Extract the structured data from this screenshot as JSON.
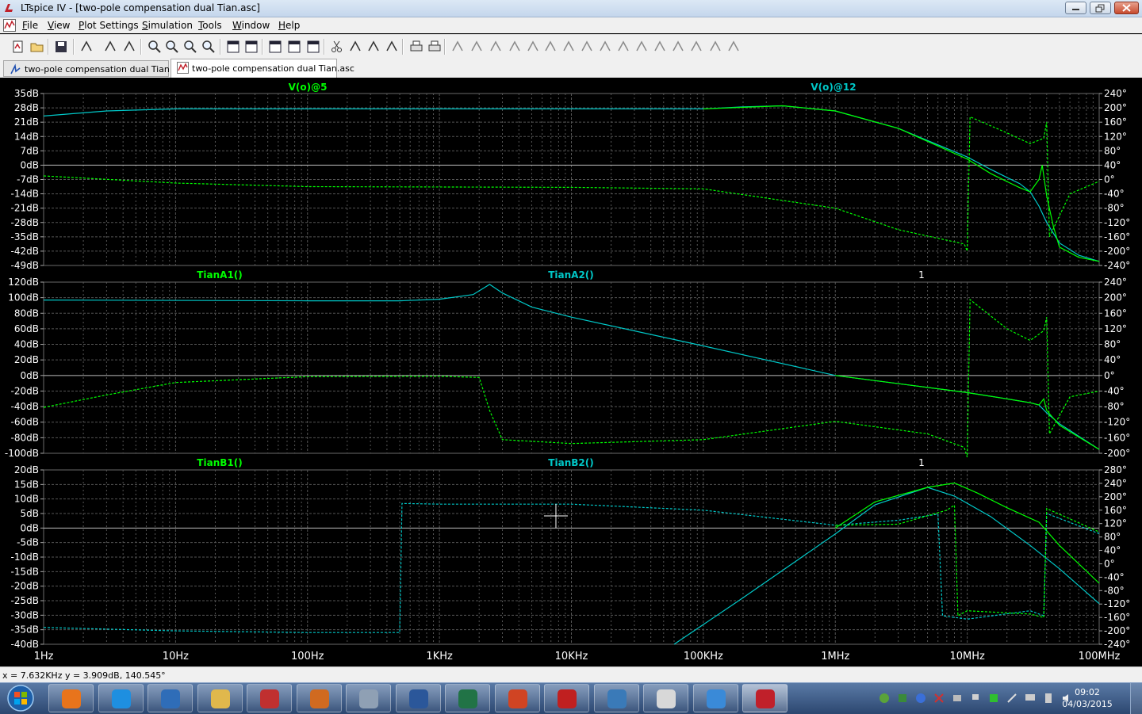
{
  "window": {
    "title": "LTspice IV - [two-pole compensation dual Tian.asc]"
  },
  "menu": [
    "File",
    "View",
    "Plot Settings",
    "Simulation",
    "Tools",
    "Window",
    "Help"
  ],
  "toolbar_icons": [
    "new-schematic-icon",
    "open-icon",
    "save-icon",
    "control-panel-icon",
    "run-icon",
    "pan-icon",
    "zoom-in-icon",
    "zoom-area-icon",
    "zoom-out-icon",
    "zoom-fit-icon",
    "autorange-icon",
    "grid-icon",
    "tile-horizontal-icon",
    "cascade-icon",
    "tile-vertical-icon",
    "cut-icon",
    "copy-icon",
    "paste-icon",
    "find-icon",
    "print-preview-icon",
    "print-icon",
    "wire-icon",
    "ground-icon",
    "label-icon",
    "resistor-icon",
    "capacitor-icon",
    "inductor-icon",
    "diode-icon",
    "component-icon",
    "move-icon",
    "drag-icon",
    "undo-icon",
    "redo-icon",
    "rotate-icon",
    "mirror-icon",
    "text-icon",
    "spice-directive-icon"
  ],
  "tabs": [
    {
      "label": "two-pole compensation dual Tian.asc",
      "kind": "schematic",
      "active": false
    },
    {
      "label": "two-pole compensation dual Tian.asc",
      "kind": "waveform",
      "active": true
    }
  ],
  "plot": {
    "x_axis": {
      "scale": "log",
      "range": [
        1,
        100000000
      ],
      "labels": [
        "1Hz",
        "10Hz",
        "100Hz",
        "1KHz",
        "10KHz",
        "100KHz",
        "1MHz",
        "10MHz",
        "100MHz"
      ]
    },
    "colors": {
      "green": "#00ff00",
      "cyan": "#00c8c8",
      "grid": "#555555",
      "axis_text": "#ffffff",
      "cursor": "#ffffff"
    },
    "panes": [
      {
        "traces": [
          {
            "label": "V(o)@5",
            "color": "green"
          },
          {
            "label": "V(o)@12",
            "color": "cyan"
          }
        ],
        "extra_label": "",
        "left_labels": [
          "35dB",
          "28dB",
          "21dB",
          "14dB",
          "7dB",
          "0dB",
          "-7dB",
          "-14dB",
          "-21dB",
          "-28dB",
          "-35dB",
          "-42dB",
          "-49dB"
        ],
        "right_labels": [
          "240°",
          "200°",
          "160°",
          "120°",
          "80°",
          "40°",
          "0°",
          "-40°",
          "-80°",
          "-120°",
          "-160°",
          "-200°",
          "-240°"
        ],
        "mag_range": [
          -49,
          35
        ],
        "phase_range": [
          -240,
          240
        ],
        "zero_db_label": "0dB",
        "curves": {
          "mag_cyan": [
            [
              1,
              24
            ],
            [
              3,
              26.5
            ],
            [
              10,
              27.5
            ],
            [
              100000.0,
              27.5
            ],
            [
              200000.0,
              28.5
            ],
            [
              400000.0,
              29
            ],
            [
              1000000.0,
              26.5
            ],
            [
              3000000.0,
              18
            ],
            [
              10000000.0,
              4
            ],
            [
              15000000.0,
              -2
            ],
            [
              20000000.0,
              -6
            ],
            [
              25000000.0,
              -9
            ],
            [
              30000000.0,
              -13
            ],
            [
              35000000.0,
              -20
            ],
            [
              40000000.0,
              -28
            ],
            [
              50000000.0,
              -38
            ],
            [
              70000000.0,
              -44
            ],
            [
              100000000.0,
              -47
            ]
          ],
          "mag_green": [
            [
              100000.0,
              27.5
            ],
            [
              400000.0,
              29
            ],
            [
              1000000.0,
              26.5
            ],
            [
              3000000.0,
              18
            ],
            [
              10000000.0,
              3
            ],
            [
              15000000.0,
              -4
            ],
            [
              20000000.0,
              -8
            ],
            [
              25000000.0,
              -11
            ],
            [
              30000000.0,
              -13
            ],
            [
              35000000.0,
              -7
            ],
            [
              37000000.0,
              0
            ],
            [
              40000000.0,
              -15
            ],
            [
              45000000.0,
              -30
            ],
            [
              50000000.0,
              -40
            ],
            [
              70000000.0,
              -45
            ],
            [
              100000000.0,
              -47
            ]
          ],
          "phase_green": [
            [
              1,
              10
            ],
            [
              10,
              -10
            ],
            [
              100,
              -20
            ],
            [
              10000.0,
              -22
            ],
            [
              100000.0,
              -26
            ],
            [
              1000000.0,
              -80
            ],
            [
              3000000.0,
              -140
            ],
            [
              9500000.0,
              -180
            ],
            [
              10000000.0,
              -200
            ],
            [
              10500000.0,
              175
            ],
            [
              20000000.0,
              130
            ],
            [
              30000000.0,
              100
            ],
            [
              38000000.0,
              115
            ],
            [
              40000000.0,
              160
            ],
            [
              42000000.0,
              -160
            ],
            [
              60000000.0,
              -40
            ],
            [
              100000000.0,
              -5
            ]
          ]
        }
      },
      {
        "traces": [
          {
            "label": "TianA1()",
            "color": "green"
          },
          {
            "label": "TianA2()",
            "color": "cyan"
          }
        ],
        "extra_label": "1",
        "left_labels": [
          "120dB",
          "100dB",
          "80dB",
          "60dB",
          "40dB",
          "20dB",
          "0dB",
          "-20dB",
          "-40dB",
          "-60dB",
          "-80dB",
          "-100dB"
        ],
        "right_labels": [
          "240°",
          "200°",
          "160°",
          "120°",
          "80°",
          "40°",
          "0°",
          "-40°",
          "-80°",
          "-120°",
          "-160°",
          "-200°"
        ],
        "mag_range": [
          -100,
          120
        ],
        "phase_range": [
          -200,
          240
        ],
        "zero_db_label": "0dB",
        "curves": {
          "mag_cyan": [
            [
              1,
              97
            ],
            [
              100,
              96
            ],
            [
              500,
              96
            ],
            [
              1000,
              98
            ],
            [
              1800,
              104
            ],
            [
              2400,
              117
            ],
            [
              3000,
              106
            ],
            [
              5000,
              88
            ],
            [
              10000.0,
              75
            ],
            [
              100000.0,
              38
            ],
            [
              1000000.0,
              0
            ],
            [
              10000000.0,
              -22
            ],
            [
              20000000.0,
              -30
            ],
            [
              30000000.0,
              -35
            ],
            [
              35000000.0,
              -38
            ],
            [
              40000000.0,
              -48
            ],
            [
              50000000.0,
              -62
            ],
            [
              100000000.0,
              -95
            ]
          ],
          "mag_green": [
            [
              1000000.0,
              0
            ],
            [
              10000000.0,
              -22
            ],
            [
              20000000.0,
              -30
            ],
            [
              30000000.0,
              -35
            ],
            [
              35000000.0,
              -38
            ],
            [
              38000000.0,
              -30
            ],
            [
              40000000.0,
              -45
            ],
            [
              50000000.0,
              -64
            ],
            [
              100000000.0,
              -95
            ]
          ],
          "phase_green": [
            [
              1,
              -82
            ],
            [
              3,
              -50
            ],
            [
              10,
              -18
            ],
            [
              100,
              -3
            ],
            [
              1000,
              -2
            ],
            [
              2000,
              -5
            ],
            [
              2400,
              -90
            ],
            [
              3000,
              -165
            ],
            [
              10000.0,
              -175
            ],
            [
              100000.0,
              -165
            ],
            [
              1000000.0,
              -118
            ],
            [
              5000000.0,
              -150
            ],
            [
              9500000.0,
              -185
            ],
            [
              10000000.0,
              -210
            ],
            [
              10500000.0,
              195
            ],
            [
              20000000.0,
              120
            ],
            [
              30000000.0,
              90
            ],
            [
              38000000.0,
              115
            ],
            [
              40000000.0,
              150
            ],
            [
              42000000.0,
              -150
            ],
            [
              60000000.0,
              -55
            ],
            [
              100000000.0,
              -40
            ]
          ]
        }
      },
      {
        "traces": [
          {
            "label": "TianB1()",
            "color": "green"
          },
          {
            "label": "TianB2()",
            "color": "cyan"
          }
        ],
        "extra_label": "1",
        "left_labels": [
          "20dB",
          "15dB",
          "10dB",
          "5dB",
          "0dB",
          "-5dB",
          "-10dB",
          "-15dB",
          "-20dB",
          "-25dB",
          "-30dB",
          "-35dB",
          "-40dB"
        ],
        "right_labels": [
          "280°",
          "240°",
          "200°",
          "160°",
          "120°",
          "80°",
          "40°",
          "0°",
          "-40°",
          "-80°",
          "-120°",
          "-160°",
          "-200°",
          "-240°"
        ],
        "mag_range": [
          -40,
          20
        ],
        "phase_range": [
          -240,
          280
        ],
        "zero_db_label": "0dB",
        "curves": {
          "mag_cyan": [
            [
              60000.0,
              -40
            ],
            [
              200000.0,
              -24
            ],
            [
              1000000.0,
              -2
            ],
            [
              2000000.0,
              8
            ],
            [
              5000000.0,
              14
            ],
            [
              8000000.0,
              11
            ],
            [
              15000000.0,
              4
            ],
            [
              30000000.0,
              -6
            ],
            [
              50000000.0,
              -14
            ],
            [
              100000000.0,
              -26
            ]
          ],
          "mag_green": [
            [
              1000000.0,
              0
            ],
            [
              2000000.0,
              9
            ],
            [
              5000000.0,
              14
            ],
            [
              8000000.0,
              15.5
            ],
            [
              12000000.0,
              12
            ],
            [
              20000000.0,
              7
            ],
            [
              35000000.0,
              2
            ],
            [
              50000000.0,
              -6
            ],
            [
              100000000.0,
              -19
            ]
          ],
          "phase_cyan": [
            [
              1,
              -190
            ],
            [
              10,
              -200
            ],
            [
              100,
              -205
            ],
            [
              500,
              -205
            ],
            [
              520,
              180
            ],
            [
              1000,
              178
            ],
            [
              10000.0,
              178
            ],
            [
              100000.0,
              160
            ],
            [
              1000000.0,
              115
            ],
            [
              3000000.0,
              130
            ],
            [
              6000000.0,
              148
            ],
            [
              6500000.0,
              -155
            ],
            [
              10000000.0,
              -165
            ],
            [
              30000000.0,
              -140
            ],
            [
              38000000.0,
              -155
            ],
            [
              40000000.0,
              150
            ],
            [
              100000000.0,
              90
            ]
          ],
          "phase_green": [
            [
              1000000.0,
              115
            ],
            [
              3000000.0,
              118
            ],
            [
              7000000.0,
              160
            ],
            [
              8000000.0,
              175
            ],
            [
              8500000.0,
              -155
            ],
            [
              10000000.0,
              -140
            ],
            [
              30000000.0,
              -150
            ],
            [
              38000000.0,
              -160
            ],
            [
              40000000.0,
              165
            ],
            [
              100000000.0,
              95
            ]
          ]
        }
      }
    ],
    "cursor": {
      "freq_hz": 7632
    }
  },
  "status": {
    "text": "x = 7.632KHz    y = 3.909dB, 140.545°"
  },
  "taskbar": {
    "apps": [
      "firefox-icon",
      "internet-explorer-icon",
      "thunderbird-icon",
      "file-explorer-icon",
      "pdf-creator-icon",
      "matlab-icon",
      "tools-icon",
      "word-icon",
      "excel-icon",
      "powerpoint-icon",
      "star-app-icon",
      "remote-desktop-icon",
      "mouse-settings-icon",
      "windows-update-icon",
      "ltspice-icon"
    ],
    "clock_time": "09:02",
    "clock_date": "04/03/2015"
  }
}
